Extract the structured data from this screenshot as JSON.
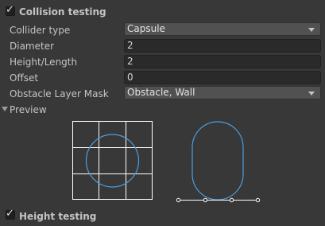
{
  "collision": {
    "enabled": true,
    "title": "Collision testing",
    "rows": {
      "collider_type": {
        "label": "Collider type",
        "value": "Capsule"
      },
      "diameter": {
        "label": "Diameter",
        "value": "2"
      },
      "height": {
        "label": "Height/Length",
        "value": "2"
      },
      "offset": {
        "label": "Offset",
        "value": "0"
      },
      "mask": {
        "label": "Obstacle Layer Mask",
        "value": "Obstacle, Wall"
      }
    }
  },
  "preview": {
    "label": "Preview"
  },
  "height_testing": {
    "enabled": true,
    "title": "Height testing"
  },
  "icons": {
    "checkbox": "checkmark-icon",
    "dropdown": "chevron-down-icon",
    "foldout": "triangle-down-icon"
  },
  "colors": {
    "background": "#383838",
    "grid": "#ffffff",
    "shape": "#4a9fe0"
  }
}
